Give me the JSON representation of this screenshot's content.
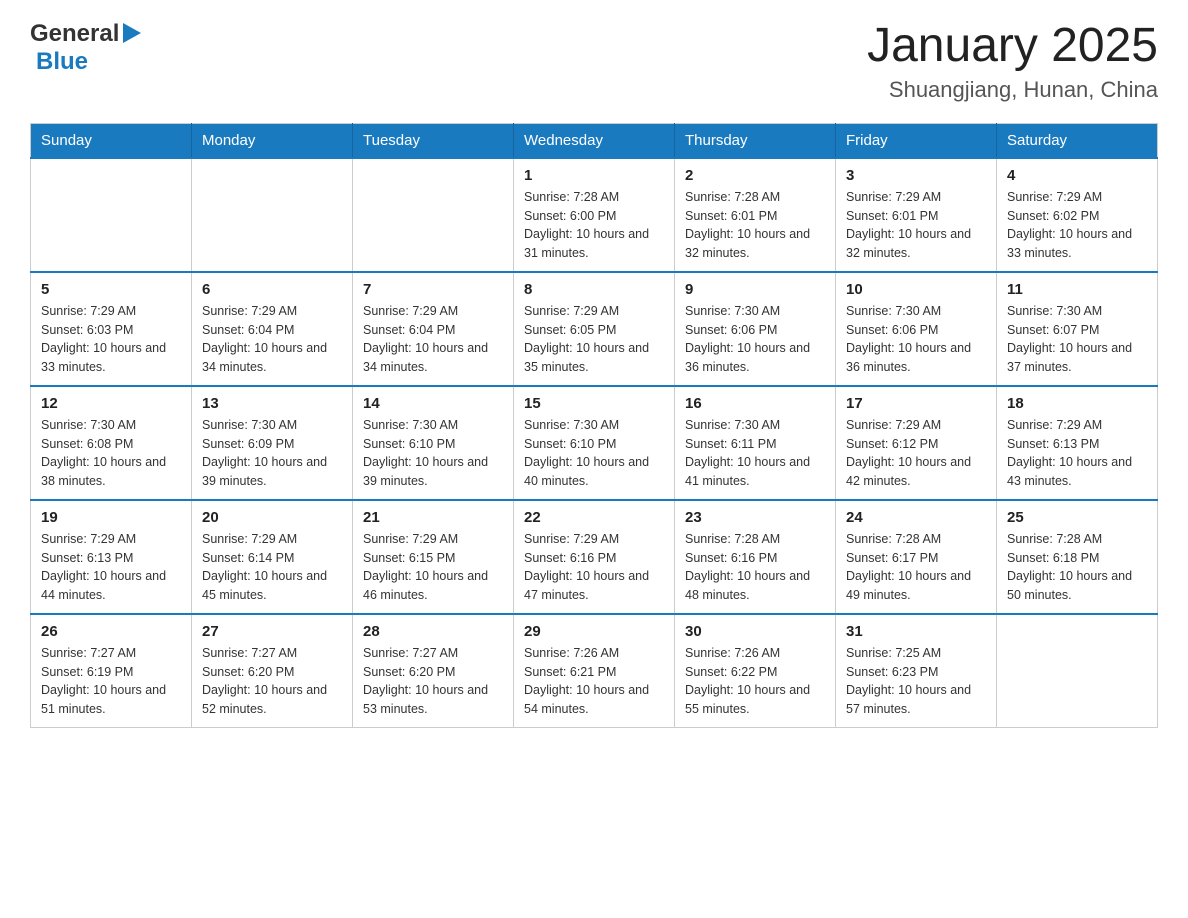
{
  "header": {
    "logo": {
      "text_general": "General",
      "text_blue": "Blue"
    },
    "month_title": "January 2025",
    "location": "Shuangjiang, Hunan, China"
  },
  "days_of_week": [
    "Sunday",
    "Monday",
    "Tuesday",
    "Wednesday",
    "Thursday",
    "Friday",
    "Saturday"
  ],
  "weeks": [
    {
      "days": [
        {
          "number": "",
          "info": ""
        },
        {
          "number": "",
          "info": ""
        },
        {
          "number": "",
          "info": ""
        },
        {
          "number": "1",
          "info": "Sunrise: 7:28 AM\nSunset: 6:00 PM\nDaylight: 10 hours and 31 minutes."
        },
        {
          "number": "2",
          "info": "Sunrise: 7:28 AM\nSunset: 6:01 PM\nDaylight: 10 hours and 32 minutes."
        },
        {
          "number": "3",
          "info": "Sunrise: 7:29 AM\nSunset: 6:01 PM\nDaylight: 10 hours and 32 minutes."
        },
        {
          "number": "4",
          "info": "Sunrise: 7:29 AM\nSunset: 6:02 PM\nDaylight: 10 hours and 33 minutes."
        }
      ]
    },
    {
      "days": [
        {
          "number": "5",
          "info": "Sunrise: 7:29 AM\nSunset: 6:03 PM\nDaylight: 10 hours and 33 minutes."
        },
        {
          "number": "6",
          "info": "Sunrise: 7:29 AM\nSunset: 6:04 PM\nDaylight: 10 hours and 34 minutes."
        },
        {
          "number": "7",
          "info": "Sunrise: 7:29 AM\nSunset: 6:04 PM\nDaylight: 10 hours and 34 minutes."
        },
        {
          "number": "8",
          "info": "Sunrise: 7:29 AM\nSunset: 6:05 PM\nDaylight: 10 hours and 35 minutes."
        },
        {
          "number": "9",
          "info": "Sunrise: 7:30 AM\nSunset: 6:06 PM\nDaylight: 10 hours and 36 minutes."
        },
        {
          "number": "10",
          "info": "Sunrise: 7:30 AM\nSunset: 6:06 PM\nDaylight: 10 hours and 36 minutes."
        },
        {
          "number": "11",
          "info": "Sunrise: 7:30 AM\nSunset: 6:07 PM\nDaylight: 10 hours and 37 minutes."
        }
      ]
    },
    {
      "days": [
        {
          "number": "12",
          "info": "Sunrise: 7:30 AM\nSunset: 6:08 PM\nDaylight: 10 hours and 38 minutes."
        },
        {
          "number": "13",
          "info": "Sunrise: 7:30 AM\nSunset: 6:09 PM\nDaylight: 10 hours and 39 minutes."
        },
        {
          "number": "14",
          "info": "Sunrise: 7:30 AM\nSunset: 6:10 PM\nDaylight: 10 hours and 39 minutes."
        },
        {
          "number": "15",
          "info": "Sunrise: 7:30 AM\nSunset: 6:10 PM\nDaylight: 10 hours and 40 minutes."
        },
        {
          "number": "16",
          "info": "Sunrise: 7:30 AM\nSunset: 6:11 PM\nDaylight: 10 hours and 41 minutes."
        },
        {
          "number": "17",
          "info": "Sunrise: 7:29 AM\nSunset: 6:12 PM\nDaylight: 10 hours and 42 minutes."
        },
        {
          "number": "18",
          "info": "Sunrise: 7:29 AM\nSunset: 6:13 PM\nDaylight: 10 hours and 43 minutes."
        }
      ]
    },
    {
      "days": [
        {
          "number": "19",
          "info": "Sunrise: 7:29 AM\nSunset: 6:13 PM\nDaylight: 10 hours and 44 minutes."
        },
        {
          "number": "20",
          "info": "Sunrise: 7:29 AM\nSunset: 6:14 PM\nDaylight: 10 hours and 45 minutes."
        },
        {
          "number": "21",
          "info": "Sunrise: 7:29 AM\nSunset: 6:15 PM\nDaylight: 10 hours and 46 minutes."
        },
        {
          "number": "22",
          "info": "Sunrise: 7:29 AM\nSunset: 6:16 PM\nDaylight: 10 hours and 47 minutes."
        },
        {
          "number": "23",
          "info": "Sunrise: 7:28 AM\nSunset: 6:16 PM\nDaylight: 10 hours and 48 minutes."
        },
        {
          "number": "24",
          "info": "Sunrise: 7:28 AM\nSunset: 6:17 PM\nDaylight: 10 hours and 49 minutes."
        },
        {
          "number": "25",
          "info": "Sunrise: 7:28 AM\nSunset: 6:18 PM\nDaylight: 10 hours and 50 minutes."
        }
      ]
    },
    {
      "days": [
        {
          "number": "26",
          "info": "Sunrise: 7:27 AM\nSunset: 6:19 PM\nDaylight: 10 hours and 51 minutes."
        },
        {
          "number": "27",
          "info": "Sunrise: 7:27 AM\nSunset: 6:20 PM\nDaylight: 10 hours and 52 minutes."
        },
        {
          "number": "28",
          "info": "Sunrise: 7:27 AM\nSunset: 6:20 PM\nDaylight: 10 hours and 53 minutes."
        },
        {
          "number": "29",
          "info": "Sunrise: 7:26 AM\nSunset: 6:21 PM\nDaylight: 10 hours and 54 minutes."
        },
        {
          "number": "30",
          "info": "Sunrise: 7:26 AM\nSunset: 6:22 PM\nDaylight: 10 hours and 55 minutes."
        },
        {
          "number": "31",
          "info": "Sunrise: 7:25 AM\nSunset: 6:23 PM\nDaylight: 10 hours and 57 minutes."
        },
        {
          "number": "",
          "info": ""
        }
      ]
    }
  ]
}
